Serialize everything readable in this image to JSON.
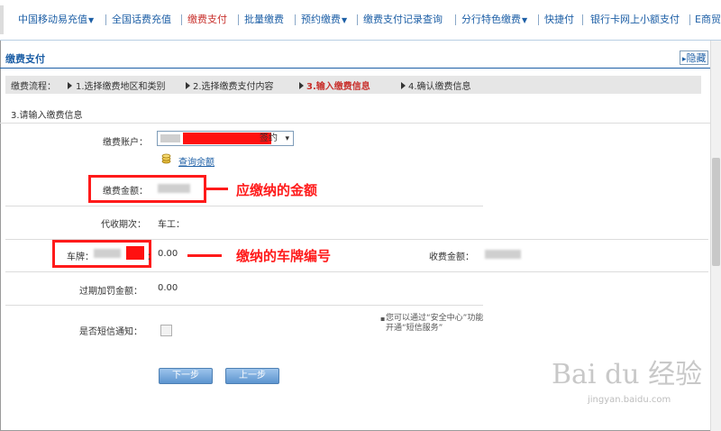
{
  "topnav": {
    "items": [
      {
        "label": "中国移动易充值",
        "caret": true
      },
      {
        "label": "全国话费充值",
        "caret": false
      },
      {
        "label": "缴费支付",
        "caret": false
      },
      {
        "label": "批量缴费",
        "caret": false
      },
      {
        "label": "预约缴费",
        "caret": true
      },
      {
        "label": "缴费支付记录查询",
        "caret": false
      },
      {
        "label": "分行特色缴费",
        "caret": true
      },
      {
        "label": "快捷付",
        "caret": false
      },
      {
        "label": "银行卡网上小额支付",
        "caret": false
      },
      {
        "label": "E商贸",
        "caret": false
      }
    ],
    "active_index": 2,
    "colors": {
      "link": "#1d5fa6",
      "active": "#c8322e"
    }
  },
  "section": {
    "title": "缴费支付",
    "hide_label": "隐藏"
  },
  "steps": {
    "prefix": "缴费流程：",
    "items": [
      "1.选择缴费地区和类别",
      "2.选择缴费支付内容",
      "3.输入缴费信息",
      "4.确认缴费信息"
    ],
    "current_index": 2
  },
  "form": {
    "subtitle": "3.请输入缴费信息",
    "account_label": "缴费账户：",
    "account_value_suffix": "签约",
    "query_balance": "查询余额",
    "amount_label": "缴费金额：",
    "period_label": "代收期次：",
    "period_value": "车工：",
    "plate_label_prefix": "车牌：",
    "plate_value": "0.00",
    "fee_label": "收费金额：",
    "late_fee_label": "过期加罚金额：",
    "late_fee_value": "0.00",
    "sms_label": "是否短信通知：",
    "sms_checked": false,
    "sms_notice": "您可以通过“安全中心”功能开通“短信服务”"
  },
  "annotations": {
    "amount_note": "应缴纳的金额",
    "plate_note": "缴纳的车牌编号",
    "color": "#ff1a1a"
  },
  "buttons": {
    "next": "下一步",
    "prev": "上一步"
  },
  "watermark": {
    "logo": "Bai du 经验",
    "url": "jingyan.baidu.com"
  }
}
